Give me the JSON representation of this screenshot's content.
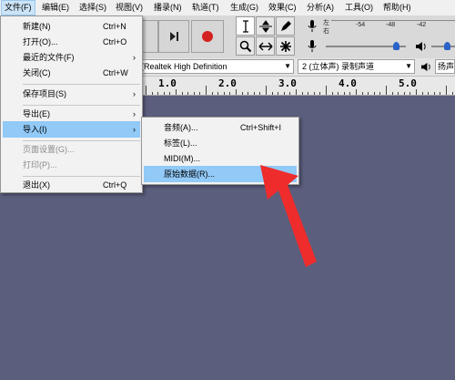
{
  "menubar": [
    {
      "label": "文件(F)",
      "active": true
    },
    {
      "label": "编辑(E)"
    },
    {
      "label": "选择(S)"
    },
    {
      "label": "视图(V)"
    },
    {
      "label": "播录(N)"
    },
    {
      "label": "轨道(T)"
    },
    {
      "label": "生成(G)"
    },
    {
      "label": "效果(C)"
    },
    {
      "label": "分析(A)"
    },
    {
      "label": "工具(O)"
    },
    {
      "label": "帮助(H)"
    }
  ],
  "file_menu": {
    "items": [
      {
        "label": "新建(N)",
        "shortcut": "Ctrl+N"
      },
      {
        "label": "打开(O)...",
        "shortcut": "Ctrl+O"
      },
      {
        "label": "最近的文件(F)",
        "submenu": true
      },
      {
        "label": "关闭(C)",
        "shortcut": "Ctrl+W"
      },
      {
        "label": "保存项目(S)",
        "submenu": true
      },
      {
        "label": "导出(E)",
        "submenu": true
      },
      {
        "label": "导入(I)",
        "submenu": true,
        "highlighted": true
      },
      {
        "label": "页面设置(G)...",
        "disabled": true
      },
      {
        "label": "打印(P)...",
        "disabled": true
      },
      {
        "label": "退出(X)",
        "shortcut": "Ctrl+Q"
      }
    ]
  },
  "import_submenu": {
    "items": [
      {
        "label": "音频(A)...",
        "shortcut": "Ctrl+Shift+I"
      },
      {
        "label": "标签(L)..."
      },
      {
        "label": "MIDI(M)..."
      },
      {
        "label": "原始数据(R)...",
        "highlighted": true
      }
    ]
  },
  "device_toolbar": {
    "output_device": "(Realtek High Definition",
    "channels": "2 (立体声) 录制声道",
    "speaker_device": "扬声"
  },
  "meter": {
    "left_channel": "左",
    "right_channel": "右",
    "scale": [
      "-54",
      "-48",
      "-42"
    ]
  },
  "ruler": {
    "ticks": [
      "1.0",
      "2.0",
      "3.0",
      "4.0",
      "5.0"
    ]
  },
  "submenu_arrow": "›",
  "colors": {
    "track_background": "#5b5e7d",
    "highlight": "#91c9f7",
    "annotation_arrow": "#ee2c2c"
  }
}
